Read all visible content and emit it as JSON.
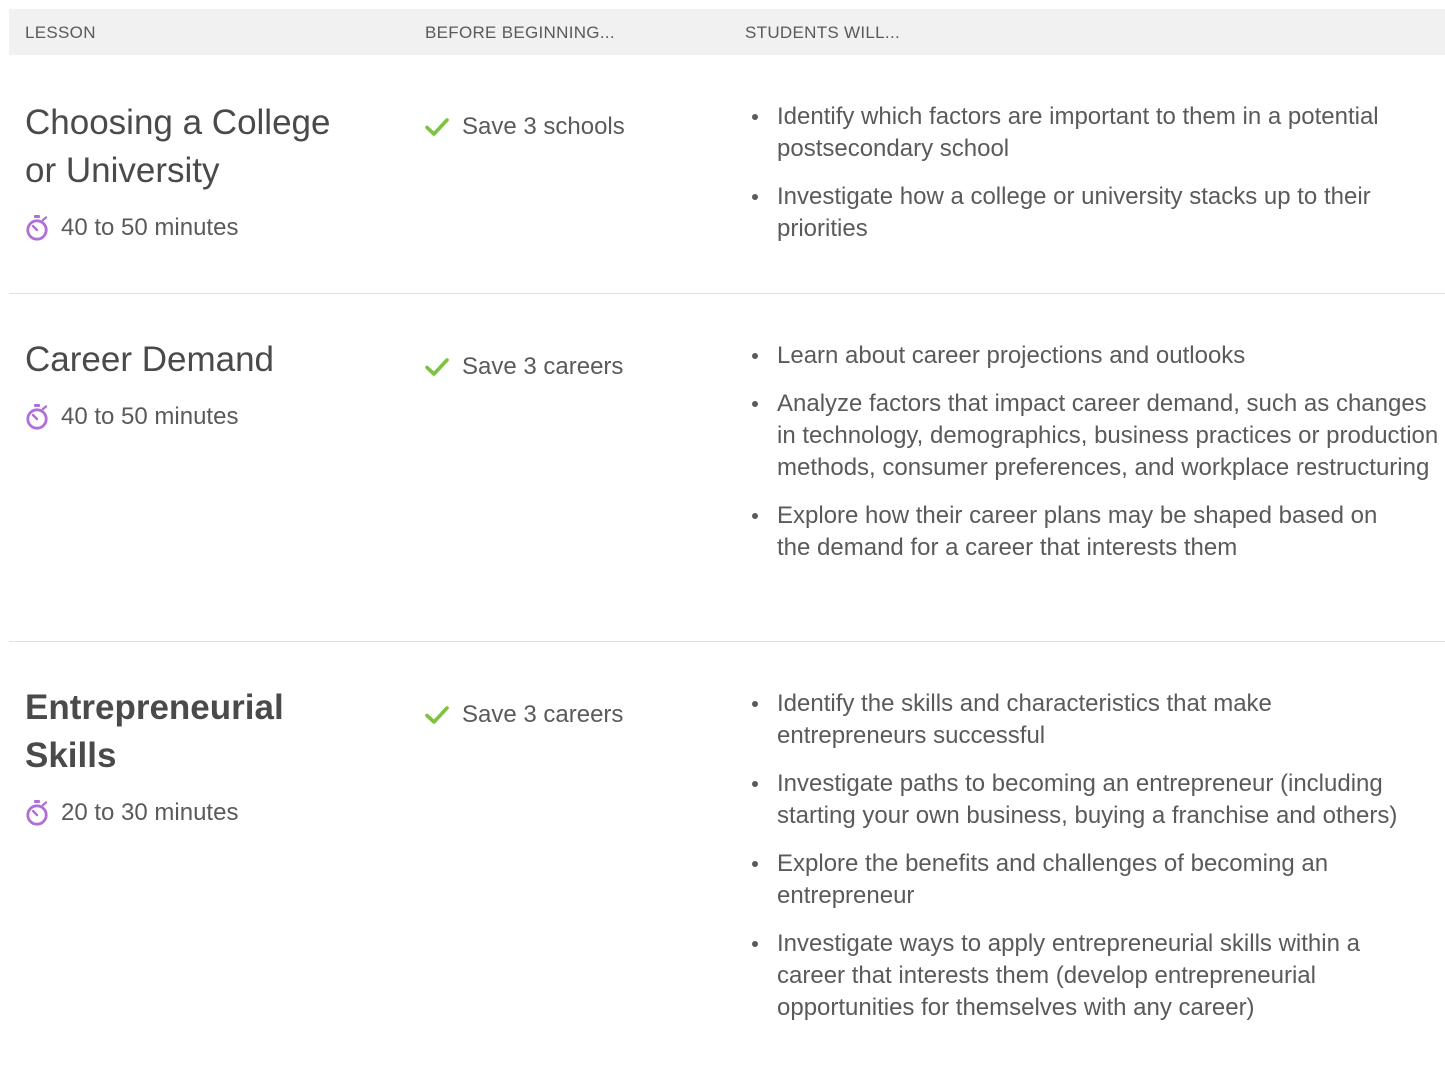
{
  "header": {
    "lesson": "LESSON",
    "before": "BEFORE BEGINNING...",
    "students": "STUDENTS WILL..."
  },
  "colors": {
    "check": "#7dc242",
    "timer": "#b06fd6",
    "header_bg": "#f1f1f1",
    "text": "#5a5a5a"
  },
  "icons": {
    "check": "check-icon",
    "timer": "stopwatch-icon"
  },
  "lessons": [
    {
      "title_line1": "Choosing a College",
      "title_line2": "or University",
      "duration": "40 to 50 minutes",
      "prerequisite": "Save 3 schools",
      "outcomes": [
        "Identify which factors are important to them in a potential postsecondary school",
        "Investigate how a college or university stacks up to their priorities"
      ]
    },
    {
      "title_line1": "Career Demand",
      "duration": "40 to 50 minutes",
      "prerequisite": "Save 3 careers",
      "outcomes": [
        "Learn about career projections and outlooks",
        "Analyze factors that impact career demand, such as changes in technology, demographics, business practices or production methods, consumer preferences, and workplace restructuring",
        "Explore how their career plans may be shaped based on the demand for a career that interests them"
      ]
    },
    {
      "title_line1": "Entrepreneurial",
      "title_line2": "Skills",
      "duration": "20 to 30 minutes",
      "prerequisite": "Save 3 careers",
      "outcomes": [
        "Identify the skills and characteristics that make entrepreneurs successful",
        "Investigate paths to becoming an entrepreneur (including starting your own business, buying a franchise and others)",
        "Explore the benefits and challenges of becoming an entrepreneur",
        "Investigate ways to apply entrepreneurial skills within a career that interests them (develop entrepreneurial opportunities for themselves with any career)"
      ]
    }
  ]
}
